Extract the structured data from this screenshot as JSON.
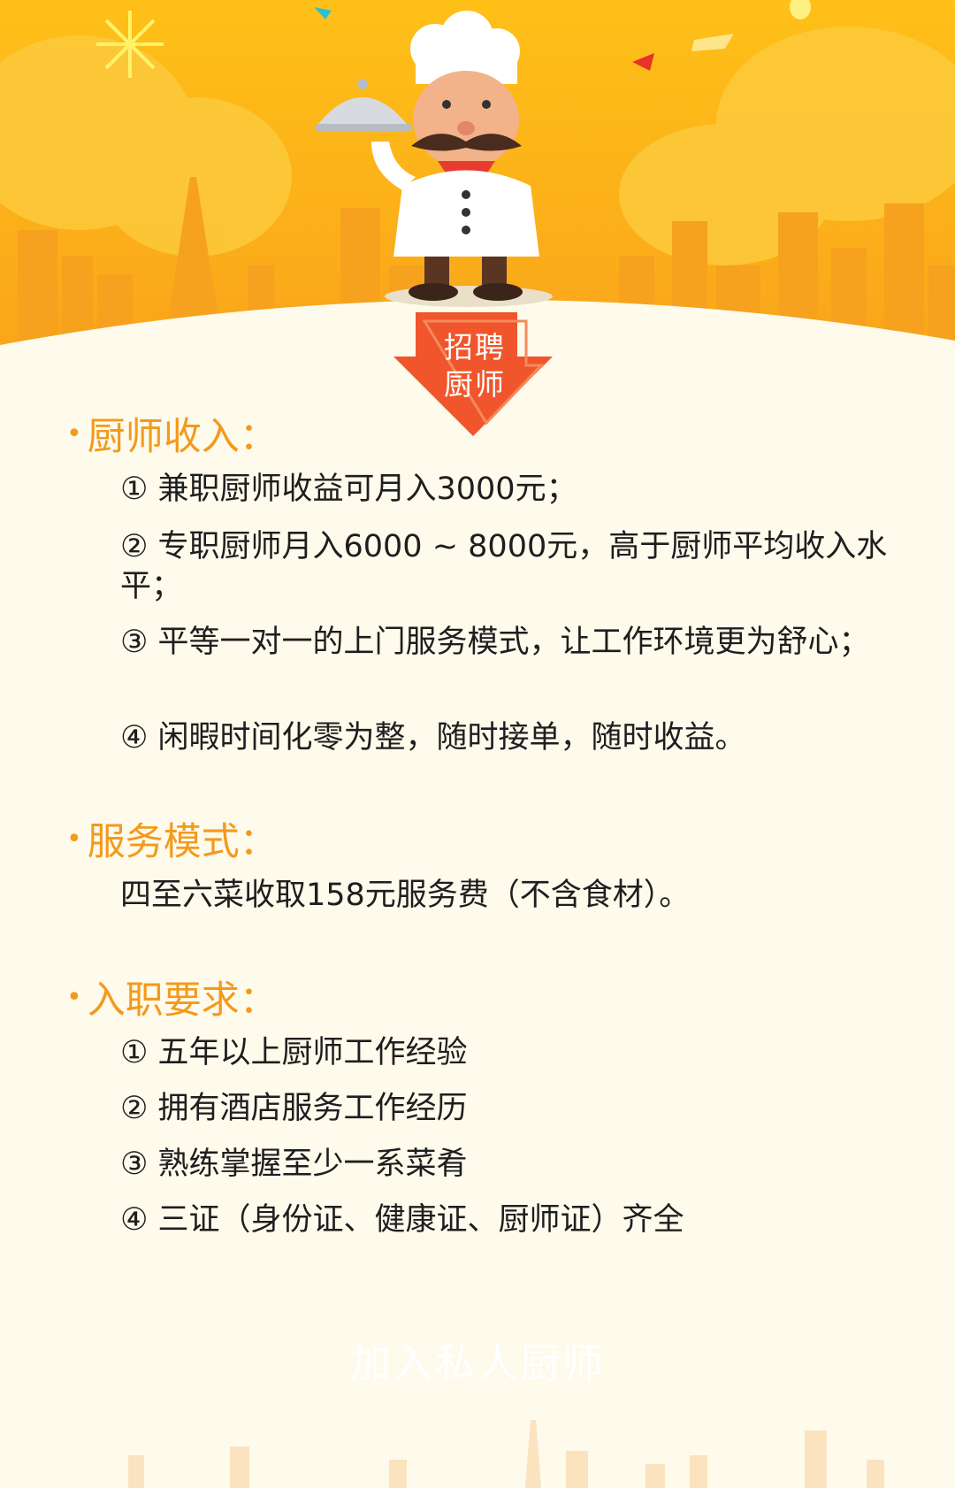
{
  "badge": {
    "line1": "招聘",
    "line2": "厨师"
  },
  "sections": [
    {
      "title": "厨师收入：",
      "items": [
        "① 兼职厨师收益可月入3000元；",
        "② 专职厨师月入6000 ~ 8000元，高于厨师平均收入水平；",
        "③ 平等一对一的上门服务模式，让工作环境更为舒心；",
        "④ 闲暇时间化零为整，随时接单，随时收益。"
      ]
    },
    {
      "title": "服务模式：",
      "items": [
        "四至六菜收取158元服务费（不含食材）。"
      ]
    },
    {
      "title": "入职要求：",
      "items": [
        "① 五年以上厨师工作经验",
        "② 拥有酒店服务工作经历",
        "③ 熟练掌握至少一系菜肴",
        "④ 三证（身份证、健康证、厨师证）齐全"
      ]
    }
  ],
  "join_button": "加入私人厨师",
  "colors": {
    "accent": "#f39a1c",
    "hero": "#fbb616",
    "background": "#fefaec",
    "badge": "#f0552c"
  }
}
